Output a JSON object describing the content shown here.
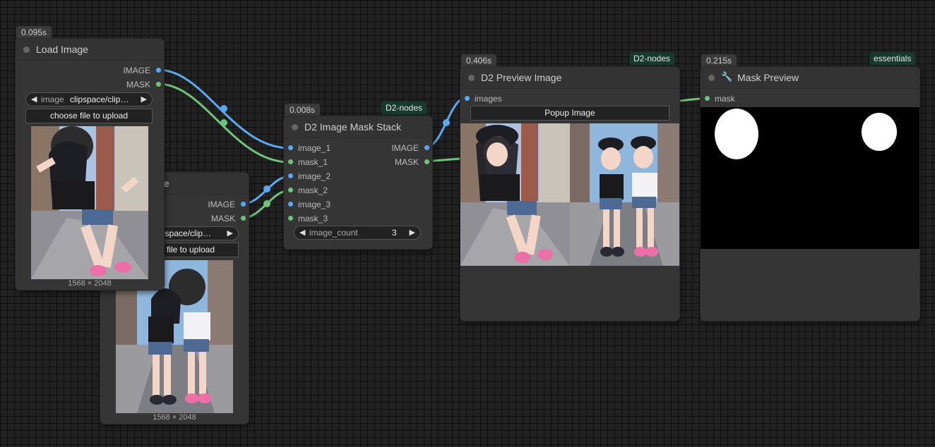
{
  "colors": {
    "image_link": "#5aa9f0",
    "mask_link": "#6cc47a",
    "tag_bg": "#163a2e",
    "canvas_bg": "#222222"
  },
  "load_image_1": {
    "time": "0.095s",
    "title": "Load Image",
    "out_image": "IMAGE",
    "out_mask": "MASK",
    "combo_label": "image",
    "combo_value": "clipspace/clip…",
    "upload_label": "choose file to upload",
    "dims": "1568 × 2048"
  },
  "load_image_2": {
    "title": "ge",
    "out_image": "IMAGE",
    "out_mask": "MASK",
    "combo_value": "pspace/clip…",
    "upload_label": "file to upload",
    "dims": "1568 × 2048"
  },
  "mask_stack": {
    "time": "0.008s",
    "tag": "D2-nodes",
    "title": "D2 Image Mask Stack",
    "inputs": [
      "image_1",
      "mask_1",
      "image_2",
      "mask_2",
      "image_3",
      "mask_3"
    ],
    "out_image": "IMAGE",
    "out_mask": "MASK",
    "count_label": "image_count",
    "count_value": "3"
  },
  "preview_image": {
    "time": "0.406s",
    "tag": "D2-nodes",
    "title": "D2 Preview Image",
    "input": "images",
    "popup_label": "Popup Image"
  },
  "mask_preview": {
    "time": "0.215s",
    "tag": "essentials",
    "title": "Mask Preview",
    "input": "mask"
  },
  "icons": {
    "arrow_left": "◀",
    "arrow_right": "▶",
    "wrench": "🔧"
  }
}
